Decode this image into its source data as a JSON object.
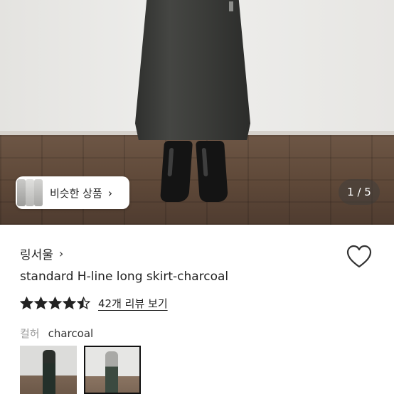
{
  "gallery": {
    "similar_button_label": "비슷한 상품",
    "page_counter": "1 / 5",
    "current_page": 1,
    "total_pages": 5
  },
  "product": {
    "shop_name": "링서울",
    "title": "standard H-line long skirt-charcoal",
    "rating": 4.5,
    "review_link": "42개 리뷰 보기",
    "color_label": "컬허",
    "color_value": "charcoal",
    "selected_swatch": 2
  },
  "icons": {
    "shop_chevron": "chevron-right-icon",
    "heart": "heart-outline-icon",
    "star": "star-icon"
  },
  "colors": {
    "star_fill": "#222222",
    "text_primary": "#222222",
    "text_muted": "#999999"
  }
}
